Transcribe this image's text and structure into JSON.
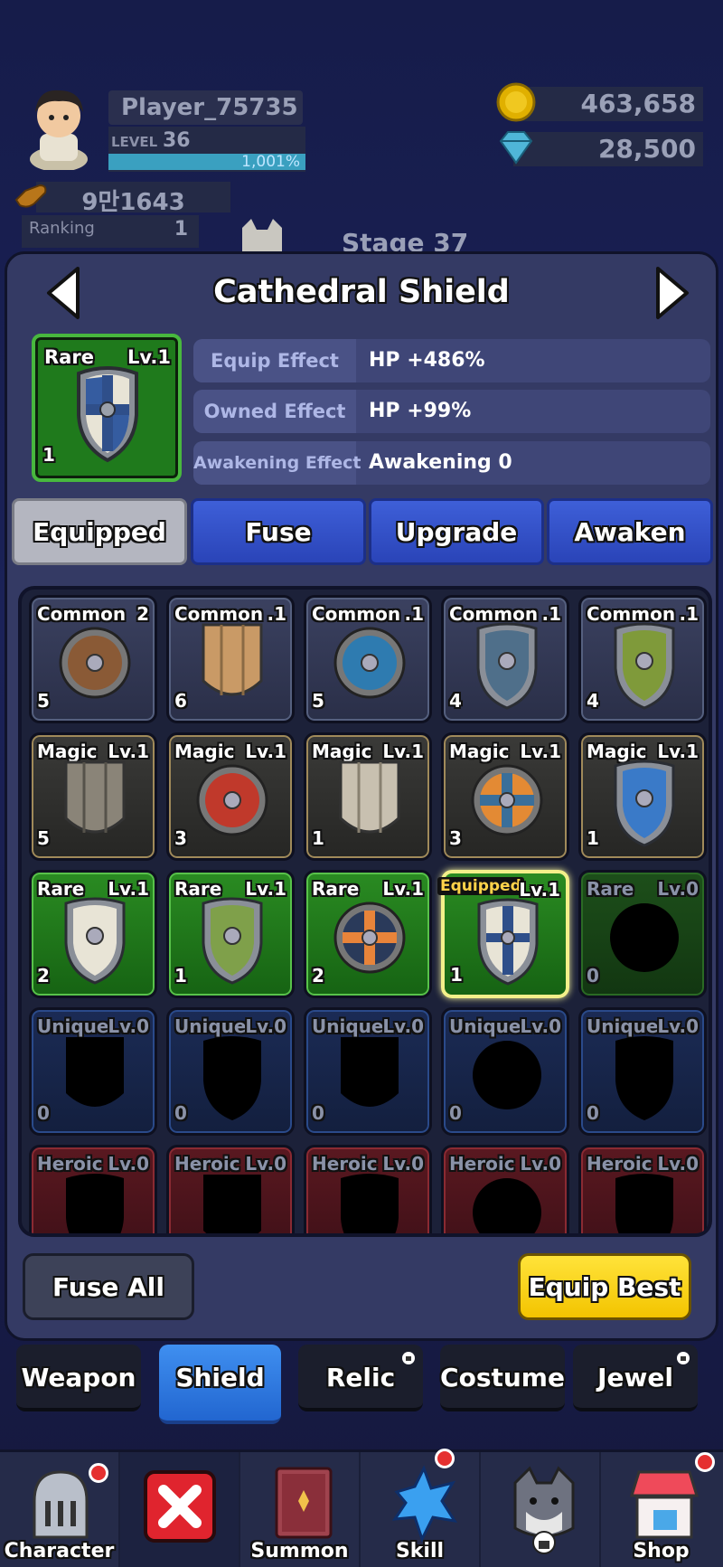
{
  "hud": {
    "player_name": "Player_75735",
    "level_label": "LEVEL",
    "level": "36",
    "exp_text": "1,001%",
    "exp_fill": 1.0,
    "power": "9만1643",
    "ranking_label": "Ranking",
    "ranking": "1",
    "stage": "Stage 37",
    "gold": "463,658",
    "gems": "28,500"
  },
  "item": {
    "title": "Cathedral Shield",
    "grade": "Rare",
    "level": "Lv.1",
    "count": "1",
    "effects": [
      {
        "label": "Equip Effect",
        "value": "HP +486%"
      },
      {
        "label": "Owned Effect",
        "value": "HP +99%"
      },
      {
        "label": "Awakening Effect",
        "value": "Awakening 0"
      }
    ]
  },
  "tabs": [
    "Equipped",
    "Fuse",
    "Upgrade",
    "Awaken"
  ],
  "grid": [
    {
      "grade": "Common",
      "lv": "2",
      "n": "5"
    },
    {
      "grade": "Common",
      "lv": ".1",
      "n": "6"
    },
    {
      "grade": "Common",
      "lv": ".1",
      "n": "5"
    },
    {
      "grade": "Common",
      "lv": ".1",
      "n": "4"
    },
    {
      "grade": "Common",
      "lv": ".1",
      "n": "4"
    },
    {
      "grade": "Magic",
      "lv": "Lv.1",
      "n": "5"
    },
    {
      "grade": "Magic",
      "lv": "Lv.1",
      "n": "3"
    },
    {
      "grade": "Magic",
      "lv": "Lv.1",
      "n": "1"
    },
    {
      "grade": "Magic",
      "lv": "Lv.1",
      "n": "3"
    },
    {
      "grade": "Magic",
      "lv": "Lv.1",
      "n": "1"
    },
    {
      "grade": "Rare",
      "lv": "Lv.1",
      "n": "2"
    },
    {
      "grade": "Rare",
      "lv": "Lv.1",
      "n": "1"
    },
    {
      "grade": "Rare",
      "lv": "Lv.1",
      "n": "2"
    },
    {
      "grade": "Equipped",
      "lv": "Lv.1",
      "n": "1"
    },
    {
      "grade": "Rare",
      "lv": "Lv.0",
      "n": "0"
    },
    {
      "grade": "Unique",
      "lv": "Lv.0",
      "n": "0"
    },
    {
      "grade": "Unique",
      "lv": "Lv.0",
      "n": "0"
    },
    {
      "grade": "Unique",
      "lv": "Lv.0",
      "n": "0"
    },
    {
      "grade": "Unique",
      "lv": "Lv.0",
      "n": "0"
    },
    {
      "grade": "Unique",
      "lv": "Lv.0",
      "n": "0"
    },
    {
      "grade": "Heroic",
      "lv": "Lv.0",
      "n": ""
    },
    {
      "grade": "Heroic",
      "lv": "Lv.0",
      "n": ""
    },
    {
      "grade": "Heroic",
      "lv": "Lv.0",
      "n": ""
    },
    {
      "grade": "Heroic",
      "lv": "Lv.0",
      "n": ""
    },
    {
      "grade": "Heroic",
      "lv": "Lv.0",
      "n": ""
    }
  ],
  "buttons": {
    "fuse_all": "Fuse All",
    "equip_best": "Equip Best"
  },
  "categories": [
    "Weapon",
    "Shield",
    "Relic",
    "Costume",
    "Jewel"
  ],
  "nav": [
    "Character",
    "",
    "Summon",
    "Skill",
    "",
    "Shop"
  ],
  "colors": {
    "accent_blue": "#2a44b8",
    "equip_yellow": "#f3c400",
    "rare_green": "#1f7a1c"
  }
}
